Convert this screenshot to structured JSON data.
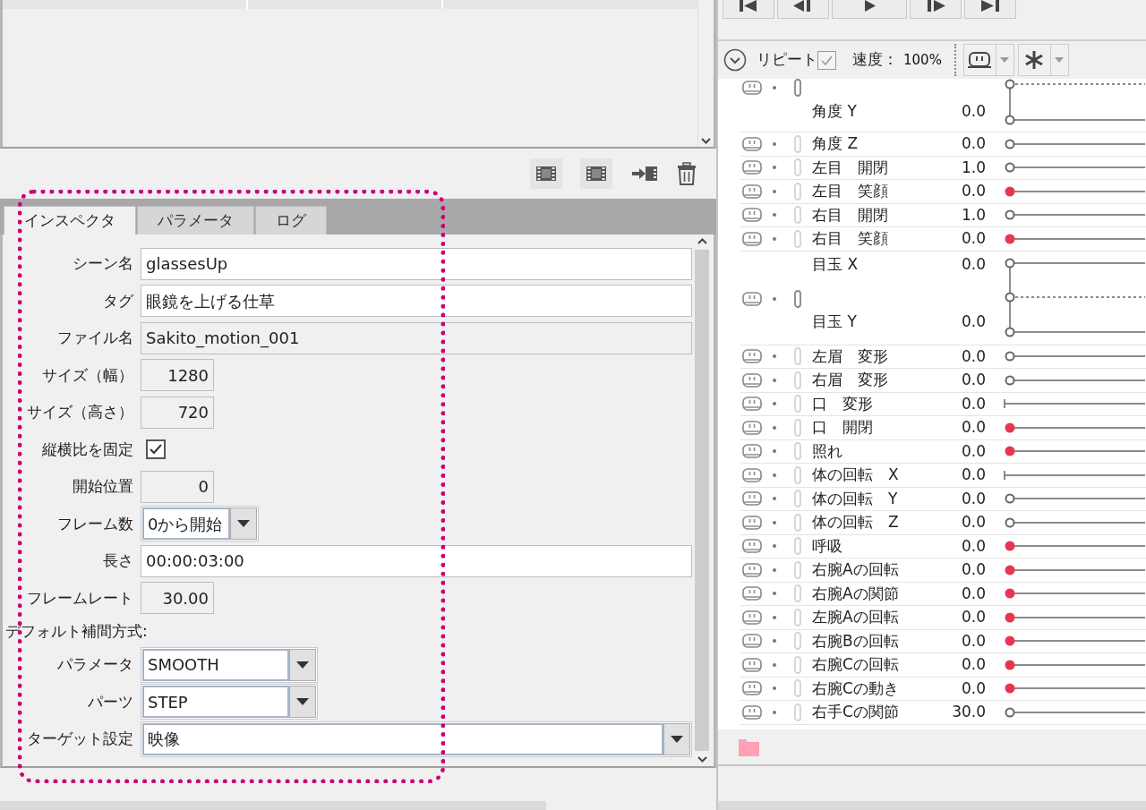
{
  "tabs": [
    {
      "label": "インスペクタ",
      "selected": true
    },
    {
      "label": "パラメータ",
      "selected": false
    },
    {
      "label": "ログ",
      "selected": false
    }
  ],
  "inspector": {
    "fields": [
      {
        "kind": "text",
        "label": "シーン名",
        "value": "glassesUp"
      },
      {
        "kind": "text",
        "label": "タグ",
        "value": "眼鏡を上げる仕草"
      },
      {
        "kind": "readonly",
        "label": "ファイル名",
        "value": "Sakito_motion_001"
      },
      {
        "kind": "number",
        "label": "サイズ（幅）",
        "value": "1280"
      },
      {
        "kind": "number",
        "label": "サイズ（高さ）",
        "value": "720"
      },
      {
        "kind": "checkbox",
        "label": "縦横比を固定",
        "checked": true
      },
      {
        "kind": "number",
        "label": "開始位置",
        "value": "0"
      },
      {
        "kind": "select",
        "label": "フレーム数",
        "value": "0から開始"
      },
      {
        "kind": "text",
        "label": "長さ",
        "value": "00:00:03:00"
      },
      {
        "kind": "number",
        "label": "フレームレート",
        "value": "30.00"
      },
      {
        "kind": "heading",
        "label": "デフォルト補間方式:"
      },
      {
        "kind": "select-medium",
        "label": "パラメータ",
        "value": "SMOOTH"
      },
      {
        "kind": "select-medium",
        "label": "パーツ",
        "value": "STEP"
      },
      {
        "kind": "select-wide",
        "label": "ターゲット設定",
        "value": "映像"
      }
    ]
  },
  "toolbar": {
    "repeat_label": "リピート",
    "repeat_checked": true,
    "speed_label": "速度：",
    "speed_value": "100%"
  },
  "parameters": [
    {
      "kind": "linked",
      "params": [
        {
          "name": "角度 Y",
          "value": "0.0",
          "keyed": false
        }
      ]
    },
    {
      "kind": "single",
      "name": "角度 Z",
      "value": "0.0",
      "keyed": false
    },
    {
      "kind": "single",
      "name": "左目　開閉",
      "value": "1.0",
      "keyed": false
    },
    {
      "kind": "single",
      "name": "左目　笑顔",
      "value": "0.0",
      "keyed": true
    },
    {
      "kind": "single",
      "name": "右目　開閉",
      "value": "1.0",
      "keyed": false
    },
    {
      "kind": "single",
      "name": "右目　笑顔",
      "value": "0.0",
      "keyed": true
    },
    {
      "kind": "linked",
      "params": [
        {
          "name": "目玉 X",
          "value": "0.0",
          "keyed": false
        },
        {
          "name": "目玉 Y",
          "value": "0.0",
          "keyed": false
        }
      ]
    },
    {
      "kind": "single",
      "name": "左眉　変形",
      "value": "0.0",
      "keyed": false
    },
    {
      "kind": "single",
      "name": "右眉　変形",
      "value": "0.0",
      "keyed": false
    },
    {
      "kind": "tick",
      "name": "口　変形",
      "value": "0.0",
      "keyed": false
    },
    {
      "kind": "single",
      "name": "口　開閉",
      "value": "0.0",
      "keyed": true
    },
    {
      "kind": "single",
      "name": "照れ",
      "value": "0.0",
      "keyed": true
    },
    {
      "kind": "tick",
      "name": "体の回転　X",
      "value": "0.0",
      "keyed": false
    },
    {
      "kind": "single",
      "name": "体の回転　Y",
      "value": "0.0",
      "keyed": false
    },
    {
      "kind": "single",
      "name": "体の回転　Z",
      "value": "0.0",
      "keyed": false
    },
    {
      "kind": "single",
      "name": "呼吸",
      "value": "0.0",
      "keyed": true
    },
    {
      "kind": "single",
      "name": "右腕Aの回転",
      "value": "0.0",
      "keyed": true
    },
    {
      "kind": "single",
      "name": "右腕Aの関節",
      "value": "0.0",
      "keyed": true
    },
    {
      "kind": "single",
      "name": "左腕Aの回転",
      "value": "0.0",
      "keyed": true
    },
    {
      "kind": "single",
      "name": "右腕Bの回転",
      "value": "0.0",
      "keyed": true
    },
    {
      "kind": "single",
      "name": "右腕Cの回転",
      "value": "0.0",
      "keyed": true
    },
    {
      "kind": "single",
      "name": "右腕Cの動き",
      "value": "0.0",
      "keyed": true
    },
    {
      "kind": "single",
      "name": "右手Cの関節",
      "value": "30.0",
      "keyed": false
    }
  ]
}
